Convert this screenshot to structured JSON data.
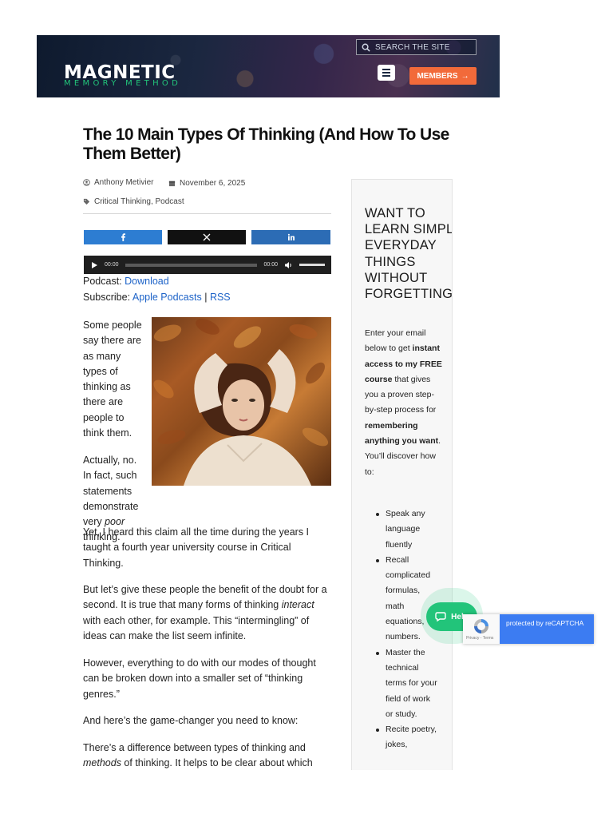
{
  "header": {
    "logo_line1": "MAGNETIC",
    "logo_line2": "MEMORY METHOD",
    "search_placeholder": "SEARCH THE SITE",
    "members_label": "MEMBERS",
    "members_arrow": "→",
    "colors": {
      "members_bg": "#f26a3a",
      "logo_accent": "#22c47a"
    }
  },
  "article": {
    "title": "The 10 Main Types Of Thinking (And How To Use Them Better)",
    "author": "Anthony Metivier",
    "date": "November 6, 2025",
    "tags": "Critical Thinking, Podcast",
    "player": {
      "current_time": "00:00",
      "duration": "00:00"
    },
    "podcast_label": "Podcast:",
    "download_link": "Download",
    "subscribe_label": "Subscribe:",
    "apple_link": "Apple Podcasts",
    "separator": "|",
    "rss_link": "RSS",
    "paragraphs": [
      "Some people say there are as many types of thinking as there are people to think them.",
      "Actually, no. In fact, such statements demonstrate very poor thinking.",
      "Yet, I heard this claim all the time during the years I taught a fourth year university course in Critical Thinking.",
      "But let’s give these people the benefit of the doubt for a second. It is true that many forms of thinking interact with each other, for example. This “intermingling” of ideas can make the list seem infinite.",
      "However, everything to do with our modes of thought can be broken down into a smaller set of “thinking genres.”",
      "And here’s the game-changer you need to know:",
      "There’s a difference between types of thinking and methods of thinking. It helps to be clear about which"
    ]
  },
  "sidebar": {
    "heading": "Want to learn simple everyday things without forgetting?",
    "intro_parts": [
      "Enter your email below to get ",
      "instant access to my FREE course",
      " that gives you a proven step-by-step process for ",
      "remembering anything you want",
      ". You’ll discover how to:"
    ],
    "list": [
      "Speak any language fluently",
      "Recall complicated formulas, math equations, numbers.",
      "Master the technical terms for your field of work or study.",
      "Recite poetry, jokes,"
    ]
  },
  "widgets": {
    "help_label": "Help",
    "recaptcha_text": "protected by reCAPTCHA",
    "recaptcha_small": "Privacy - Terms"
  }
}
